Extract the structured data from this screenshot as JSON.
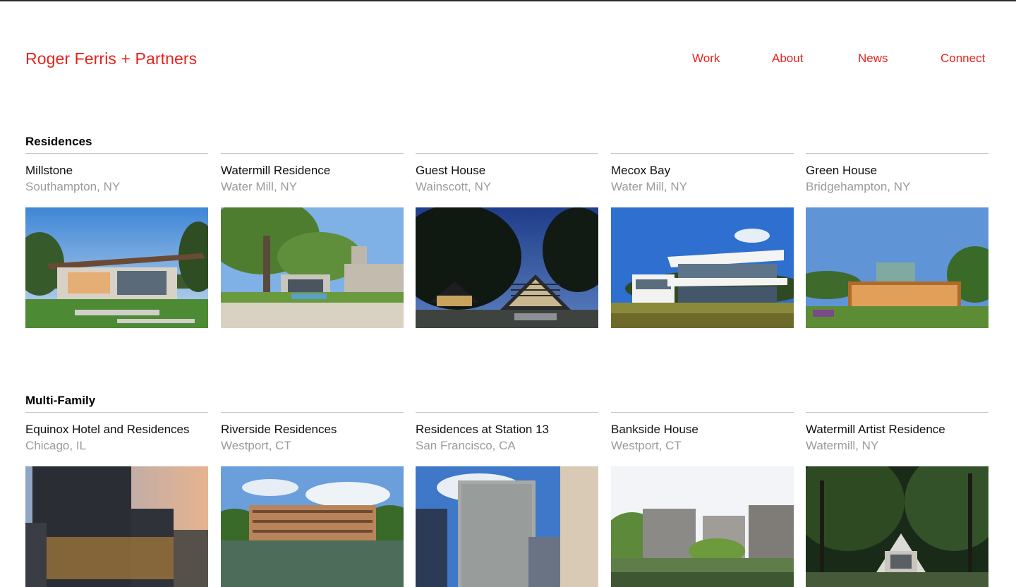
{
  "header": {
    "logo": "Roger Ferris + Partners",
    "nav": [
      "Work",
      "About",
      "News",
      "Connect"
    ]
  },
  "sections": [
    {
      "title": "Residences",
      "projects": [
        {
          "name": "Millstone",
          "location": "Southampton, NY"
        },
        {
          "name": "Watermill Residence",
          "location": "Water Mill, NY"
        },
        {
          "name": "Guest House",
          "location": "Wainscott, NY"
        },
        {
          "name": "Mecox Bay",
          "location": "Water Mill, NY"
        },
        {
          "name": "Green House",
          "location": "Bridgehampton, NY"
        }
      ]
    },
    {
      "title": "Multi-Family",
      "projects": [
        {
          "name": "Equinox Hotel and Residences",
          "location": "Chicago, IL"
        },
        {
          "name": "Riverside Residences",
          "location": "Westport, CT"
        },
        {
          "name": "Residences at Station 13",
          "location": "San Francisco, CA"
        },
        {
          "name": "Bankside House",
          "location": "Westport, CT"
        },
        {
          "name": "Watermill Artist Residence",
          "location": "Watermill, NY"
        }
      ]
    }
  ],
  "colors": {
    "brand": "#e8231c",
    "text": "#111111",
    "muted": "#9b9b9b",
    "rule": "#c7c7c7"
  }
}
